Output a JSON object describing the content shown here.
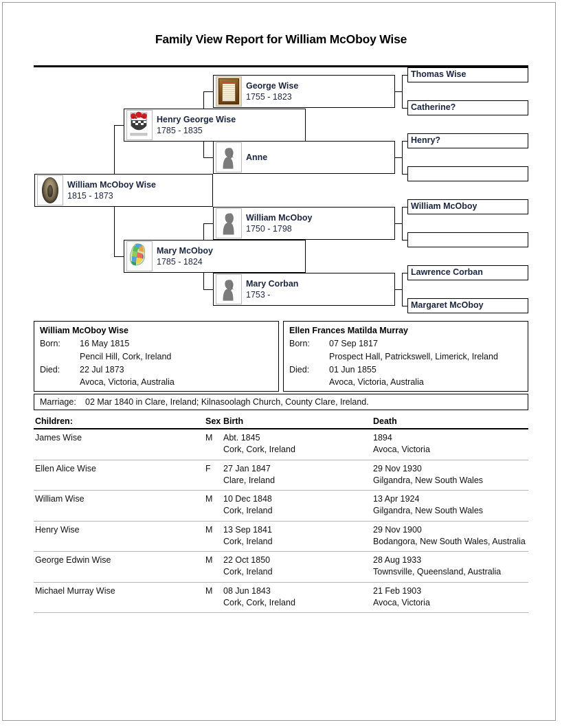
{
  "report": {
    "title": "Family View Report for William McOboy Wise"
  },
  "pedigree": {
    "subject": {
      "name": "William McOboy Wise",
      "dates": "1815 - 1873",
      "thumb": "portrait-photo-icon"
    },
    "father": {
      "name": "Henry George Wise",
      "dates": "1785 - 1835",
      "thumb": "coat-of-arms-icon"
    },
    "mother": {
      "name": "Mary McOboy",
      "dates": "1785 - 1824",
      "thumb": "ireland-map-icon"
    },
    "paternal_grandfather": {
      "name": "George Wise",
      "dates": "1755 - 1823",
      "thumb": "certificate-icon"
    },
    "paternal_grandmother": {
      "name": "Anne",
      "dates": "",
      "thumb": "female-silhouette-icon"
    },
    "maternal_grandfather": {
      "name": "William McOboy",
      "dates": "1750 - 1798",
      "thumb": "male-silhouette-icon"
    },
    "maternal_grandmother": {
      "name": "Mary Corban",
      "dates": "1753 -",
      "thumb": "female-silhouette-icon"
    },
    "great_grandparents": [
      {
        "name": "Thomas Wise"
      },
      {
        "name": "Catherine?"
      },
      {
        "name": "Henry?"
      },
      {
        "name": ""
      },
      {
        "name": "William McOboy"
      },
      {
        "name": ""
      },
      {
        "name": "Lawrence Corban"
      },
      {
        "name": "Margaret McOboy"
      }
    ]
  },
  "details": {
    "born_label": "Born:",
    "died_label": "Died:",
    "husband": {
      "name": "William McOboy Wise",
      "born_date": "16 May 1815",
      "born_place": "Pencil Hill, Cork, Ireland",
      "died_date": "22 Jul 1873",
      "died_place": "Avoca, Victoria, Australia"
    },
    "wife": {
      "name": "Ellen Frances Matilda Murray",
      "born_date": "07 Sep 1817",
      "born_place": "Prospect Hall, Patrickswell, Limerick, Ireland",
      "died_date": "01 Jun 1855",
      "died_place": "Avoca, Victoria, Australia"
    }
  },
  "marriage": {
    "label": "Marriage:",
    "text": "02 Mar 1840 in Clare, Ireland; Kilnasoolagh Church, County Clare, Ireland."
  },
  "children": {
    "headers": {
      "name": "Children:",
      "sex": "Sex",
      "birth": "Birth",
      "death": "Death"
    },
    "rows": [
      {
        "name": "James Wise",
        "sex": "M",
        "birth_date": "Abt. 1845",
        "birth_place": "Cork, Cork, Ireland",
        "death_date": "1894",
        "death_place": "Avoca, Victoria"
      },
      {
        "name": "Ellen Alice Wise",
        "sex": "F",
        "birth_date": "27 Jan 1847",
        "birth_place": "Clare, Ireland",
        "death_date": "29 Nov 1930",
        "death_place": "Gilgandra, New South Wales"
      },
      {
        "name": "William Wise",
        "sex": "M",
        "birth_date": "10 Dec 1848",
        "birth_place": "Cork, Ireland",
        "death_date": "13 Apr 1924",
        "death_place": "Gilgandra, New South Wales"
      },
      {
        "name": "Henry Wise",
        "sex": "M",
        "birth_date": "13 Sep 1841",
        "birth_place": "Cork, Ireland",
        "death_date": "29 Nov 1900",
        "death_place": "Bodangora, New South Wales, Australia"
      },
      {
        "name": "George Edwin Wise",
        "sex": "M",
        "birth_date": "22 Oct 1850",
        "birth_place": "Cork, Ireland",
        "death_date": "28 Aug 1933",
        "death_place": "Townsville, Queensland, Australia"
      },
      {
        "name": "Michael Murray Wise",
        "sex": "M",
        "birth_date": "08 Jun 1843",
        "birth_place": "Cork, Cork, Ireland",
        "death_date": "21 Feb 1903",
        "death_place": "Avoca, Victoria"
      }
    ]
  },
  "colors": {
    "name_text": "#1b2540",
    "border": "#000000",
    "row_rule": "#b6b6b6"
  }
}
